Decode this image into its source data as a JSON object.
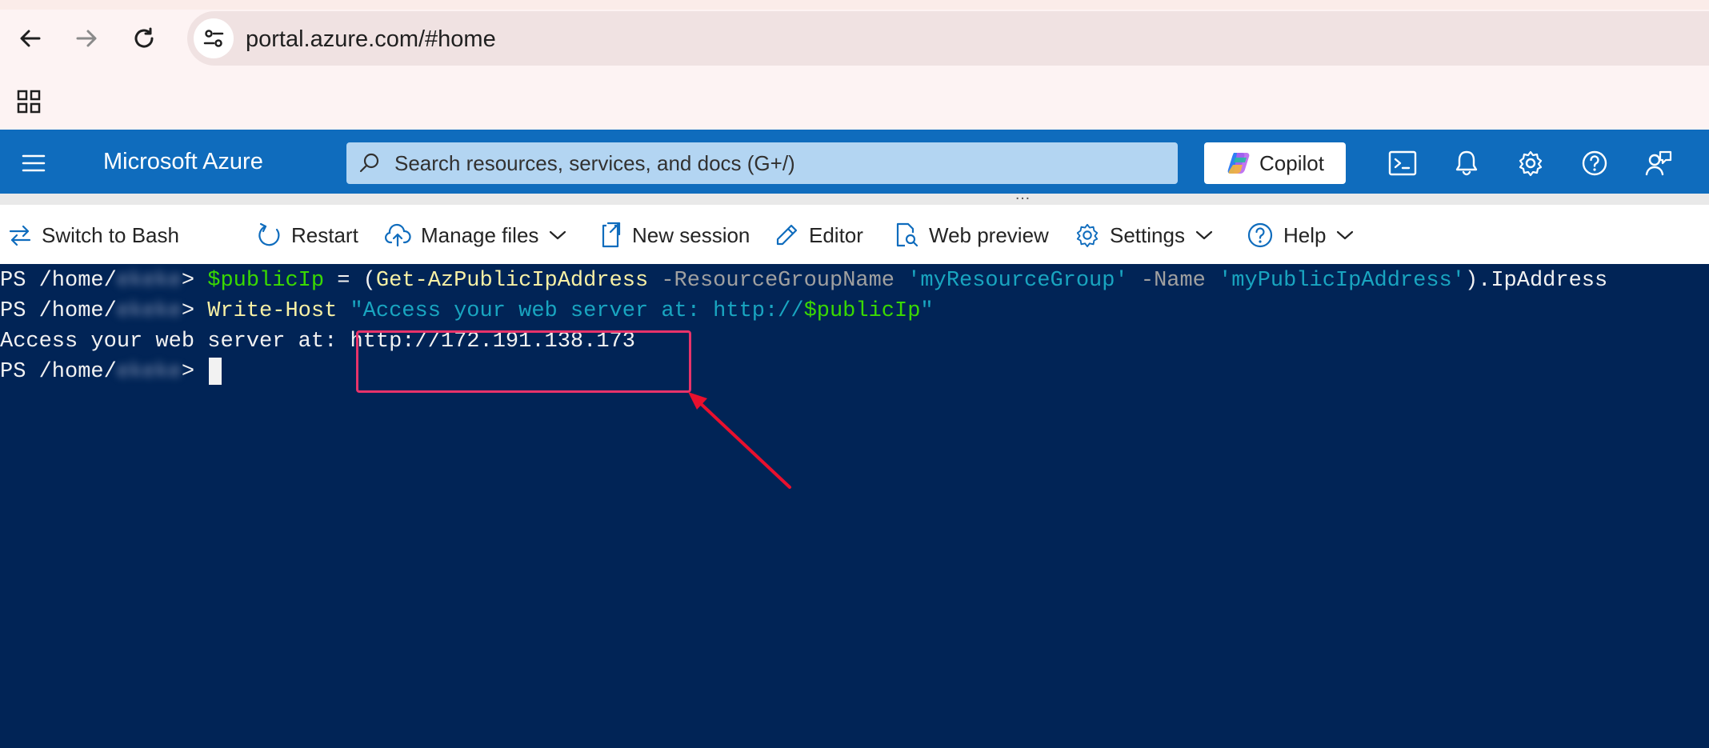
{
  "browser": {
    "url": "portal.azure.com/#home"
  },
  "azure": {
    "brand": "Microsoft Azure",
    "search_placeholder": "Search resources, services, and docs (G+/)",
    "copilot_label": "Copilot"
  },
  "toolbar": {
    "switch_label": "Switch to Bash",
    "restart_label": "Restart",
    "manage_files_label": "Manage files",
    "new_session_label": "New session",
    "editor_label": "Editor",
    "web_preview_label": "Web preview",
    "settings_label": "Settings",
    "help_label": "Help"
  },
  "terminal": {
    "prompt_prefix": "PS /home/",
    "prompt_user": "ekeke",
    "prompt_suffix": ">",
    "line1": {
      "var": "$publicIp",
      "eq": " = (",
      "cmd": "Get-AzPublicIpAddress",
      "param1": " -ResourceGroupName ",
      "val1": "'myResourceGroup'",
      "param2": " -Name ",
      "val2": "'myPublicIpAddress'",
      "tail": ").IpAddress"
    },
    "line2": {
      "cmd": "Write-Host",
      "str_open": " \"Access your web server at: http://",
      "var": "$publicIp",
      "str_close": "\""
    },
    "output_prefix": "Access your web server at: ",
    "output_url": "http://172.191.138.173"
  },
  "colors": {
    "terminal_bg": "#012456",
    "azure_blue": "#0f6cbd",
    "annotation": "#e8336a"
  }
}
